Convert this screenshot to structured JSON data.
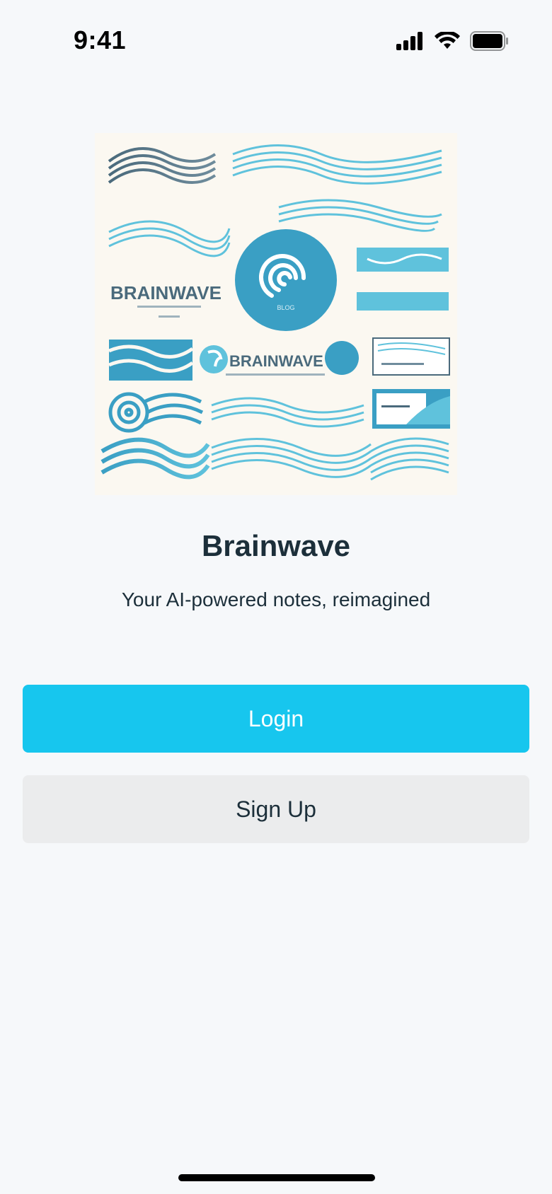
{
  "status_bar": {
    "time": "9:41",
    "icons": [
      "cellular-signal-icon",
      "wifi-icon",
      "battery-icon"
    ]
  },
  "hero": {
    "logo_text_1": "BRAINWAVE",
    "logo_text_2": "BRAINWAVE",
    "badge_text": "BLOG"
  },
  "app": {
    "title": "Brainwave",
    "tagline": "Your AI-powered notes, reimagined"
  },
  "buttons": {
    "login_label": "Login",
    "signup_label": "Sign Up"
  },
  "colors": {
    "background": "#f6f8fa",
    "primary": "#17c6ee",
    "secondary": "#ebeced",
    "text": "#1c2f3a",
    "wave_blue": "#3a9fc4",
    "wave_light": "#5fc2dc",
    "wave_dark": "#4a6a7c"
  }
}
